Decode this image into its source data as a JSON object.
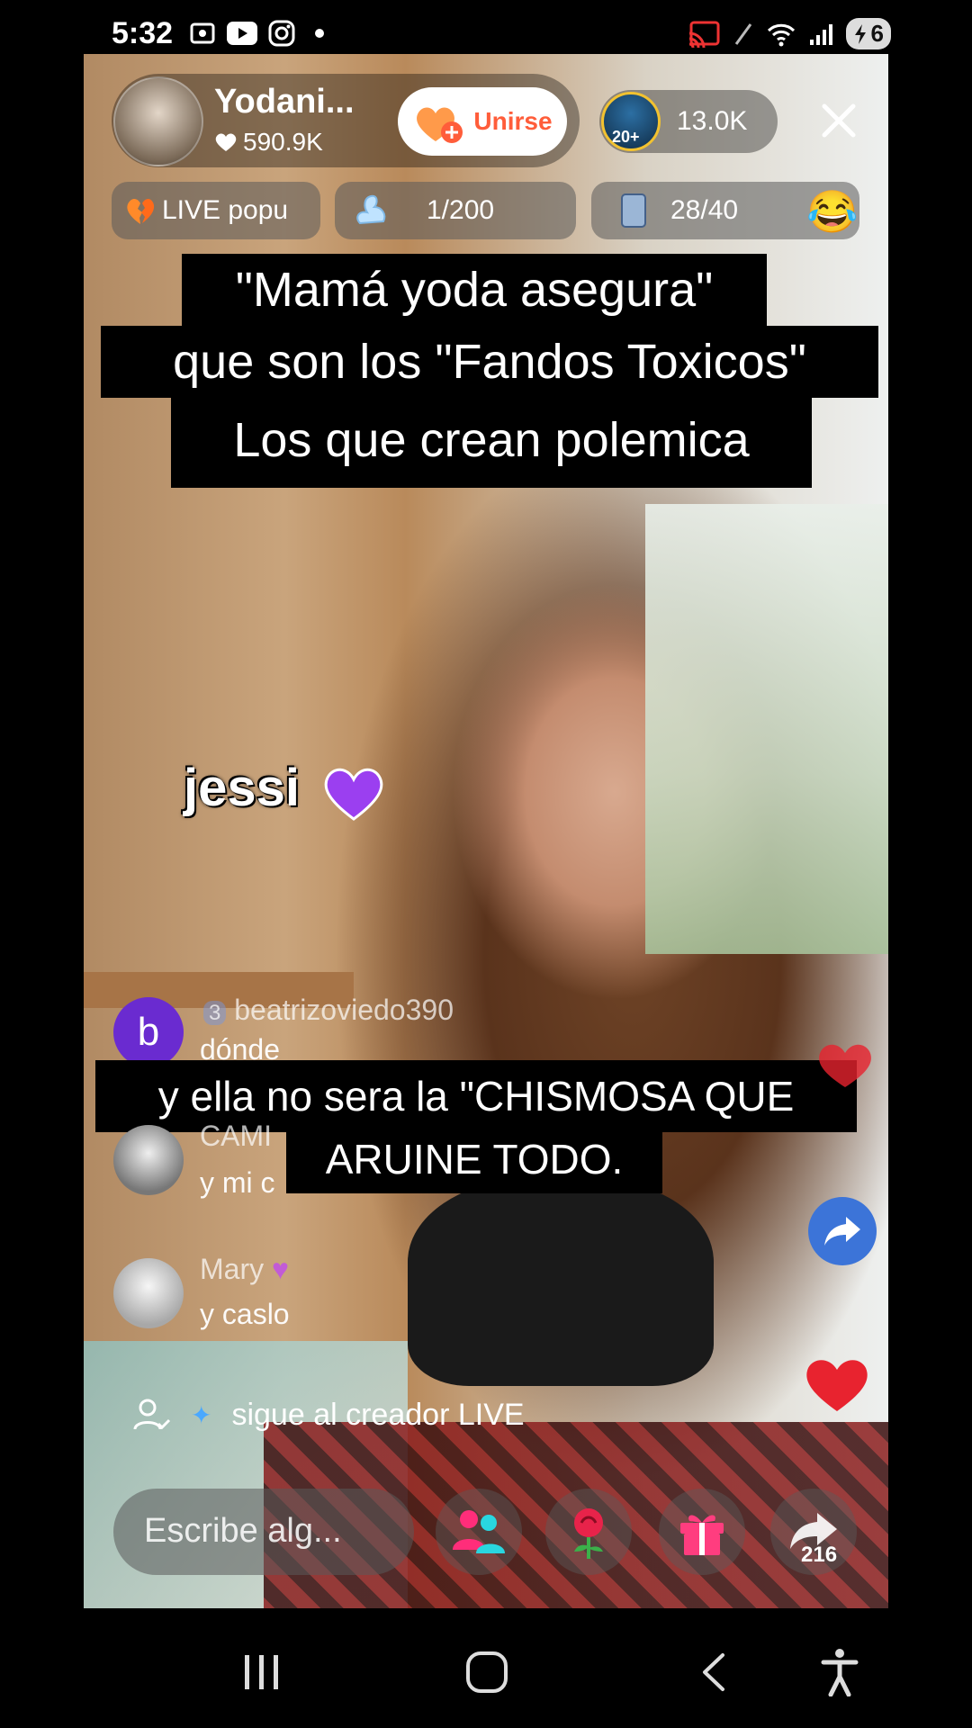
{
  "status_bar": {
    "time": "5:32",
    "battery": "6",
    "icons": [
      "screen-record-icon",
      "youtube-icon",
      "instagram-icon",
      "dot-icon",
      "cast-icon",
      "pen-icon",
      "wifi-icon",
      "signal-icon",
      "battery-icon"
    ]
  },
  "host": {
    "name": "Yodani...",
    "likes": "590.9K",
    "join_label": "Unirse"
  },
  "viewers": {
    "badge": "20+",
    "count": "13.0K"
  },
  "pills": {
    "live_label": "LIVE popu",
    "rank_value": "1/200",
    "gift_value": "28/40"
  },
  "captions": {
    "line1": "\"Mamá yoda asegura\"",
    "line2": "que son los \"Fandos Toxicos\"",
    "line3": "Los que crean polemica",
    "line4": "y ella no sera la \"CHISMOSA QUE",
    "line5": "ARUINE TODO."
  },
  "overlay_name": "jessi",
  "comments": [
    {
      "avatar_letter": "b",
      "level": "3",
      "name": "beatrizoviedo390",
      "text": "dónde"
    },
    {
      "name": "CAMI",
      "text": "y mi c"
    },
    {
      "name": "Mary",
      "text": "y caslo"
    }
  ],
  "follow_prompt": "sigue al creador LIVE",
  "input": {
    "placeholder": "Escribe alg..."
  },
  "share_count": "216",
  "colors": {
    "join_text": "#ff5d3a",
    "avatar_b": "#6a2bd0",
    "share_float": "#3c74d8",
    "heart": "#e8232f",
    "viewer_ring": "#f2c230"
  }
}
